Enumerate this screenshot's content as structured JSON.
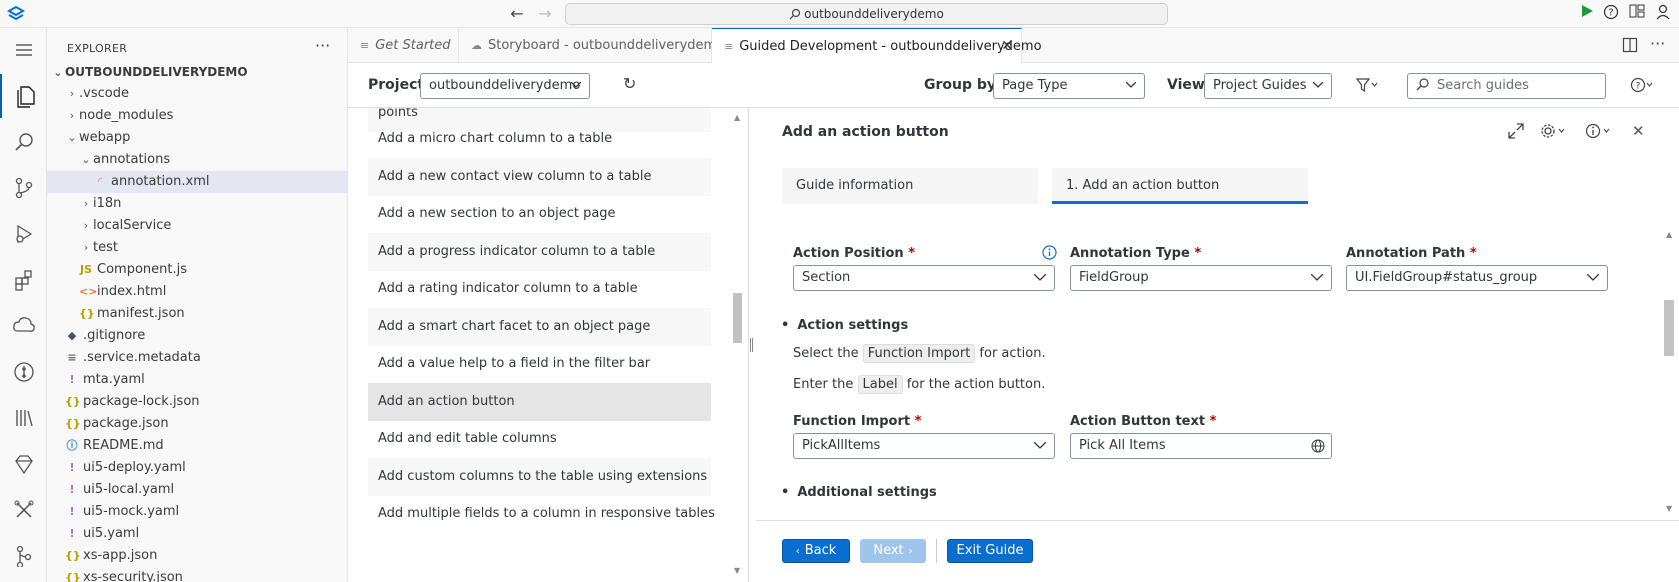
{
  "titlebar": {
    "search_text": "outbounddeliverydemo"
  },
  "explorer": {
    "title": "EXPLORER",
    "root": "OUTBOUNDDELIVERYDEMO",
    "items": [
      {
        "label": ".vscode",
        "type": "folder-collapsed",
        "depth": 1
      },
      {
        "label": "node_modules",
        "type": "folder-collapsed",
        "depth": 1
      },
      {
        "label": "webapp",
        "type": "folder-expanded",
        "depth": 1
      },
      {
        "label": "annotations",
        "type": "folder-expanded",
        "depth": 2
      },
      {
        "label": "annotation.xml",
        "type": "file",
        "icon": "rss",
        "depth": 3
      },
      {
        "label": "i18n",
        "type": "folder-collapsed",
        "depth": 2
      },
      {
        "label": "localService",
        "type": "folder-collapsed",
        "depth": 2
      },
      {
        "label": "test",
        "type": "folder-collapsed",
        "depth": 2
      },
      {
        "label": "Component.js",
        "type": "file",
        "icon": "JS",
        "depth": 2
      },
      {
        "label": "index.html",
        "type": "file",
        "icon": "<>",
        "depth": 2
      },
      {
        "label": "manifest.json",
        "type": "file",
        "icon": "{}",
        "depth": 2
      },
      {
        "label": ".gitignore",
        "type": "file",
        "icon": "◆",
        "depth": 1
      },
      {
        "label": ".service.metadata",
        "type": "file",
        "icon": "≡",
        "depth": 1
      },
      {
        "label": "mta.yaml",
        "type": "file",
        "icon": "!",
        "depth": 1
      },
      {
        "label": "package-lock.json",
        "type": "file",
        "icon": "{}",
        "depth": 1
      },
      {
        "label": "package.json",
        "type": "file",
        "icon": "{}",
        "depth": 1
      },
      {
        "label": "README.md",
        "type": "file",
        "icon": "ⓘ",
        "depth": 1
      },
      {
        "label": "ui5-deploy.yaml",
        "type": "file",
        "icon": "!",
        "depth": 1
      },
      {
        "label": "ui5-local.yaml",
        "type": "file",
        "icon": "!",
        "depth": 1
      },
      {
        "label": "ui5-mock.yaml",
        "type": "file",
        "icon": "!",
        "depth": 1
      },
      {
        "label": "ui5.yaml",
        "type": "file",
        "icon": "!",
        "depth": 1
      },
      {
        "label": "xs-app.json",
        "type": "file",
        "icon": "{}",
        "depth": 1
      },
      {
        "label": "xs-security.json",
        "type": "file",
        "icon": "{}",
        "depth": 1
      }
    ]
  },
  "tabs": [
    {
      "label": "Get Started",
      "italic": true
    },
    {
      "label": "Storyboard - outbounddeliverydemo",
      "italic": false
    },
    {
      "label": "Guided Development - outbounddeliverydemo",
      "italic": false,
      "active": true
    }
  ],
  "toolbar": {
    "project_label": "Project",
    "project_value": "outbounddeliverydemo",
    "groupby_label": "Group by",
    "groupby_value": "Page Type",
    "view_label": "View",
    "view_value": "Project Guides",
    "search_placeholder": "Search guides"
  },
  "guides": [
    "points",
    "Add a micro chart column to a table",
    "Add a new contact view column to a table",
    "Add a new section to an object page",
    "Add a progress indicator column to a table",
    "Add a rating indicator column to a table",
    "Add a smart chart facet to an object page",
    "Add a value help to a field in the filter bar",
    "Add an action button",
    "Add and edit table columns",
    "Add custom columns to the table using extensions",
    "Add multiple fields to a column in responsive tables"
  ],
  "detail": {
    "title": "Add an action button",
    "tabs": [
      "Guide information",
      "1. Add an action button"
    ],
    "fields": {
      "action_position": {
        "label": "Action Position",
        "value": "Section"
      },
      "annotation_type": {
        "label": "Annotation Type",
        "value": "FieldGroup"
      },
      "annotation_path": {
        "label": "Annotation Path",
        "value": "UI.FieldGroup#status_group"
      }
    },
    "action_settings": {
      "title": "Action settings",
      "line1_pre": "Select the ",
      "line1_key": "Function Import",
      "line1_post": " for action.",
      "line2_pre": "Enter the ",
      "line2_key": "Label",
      "line2_post": " for the action button.",
      "function_import": {
        "label": "Function Import",
        "value": "PickAllItems"
      },
      "action_text": {
        "label": "Action Button text",
        "value": "Pick All Items"
      }
    },
    "additional_settings": {
      "title": "Additional settings"
    },
    "buttons": {
      "back": "Back",
      "next": "Next",
      "exit": "Exit Guide"
    }
  },
  "colors": {
    "accent": "#0a6ed1",
    "required": "#bb0000"
  }
}
